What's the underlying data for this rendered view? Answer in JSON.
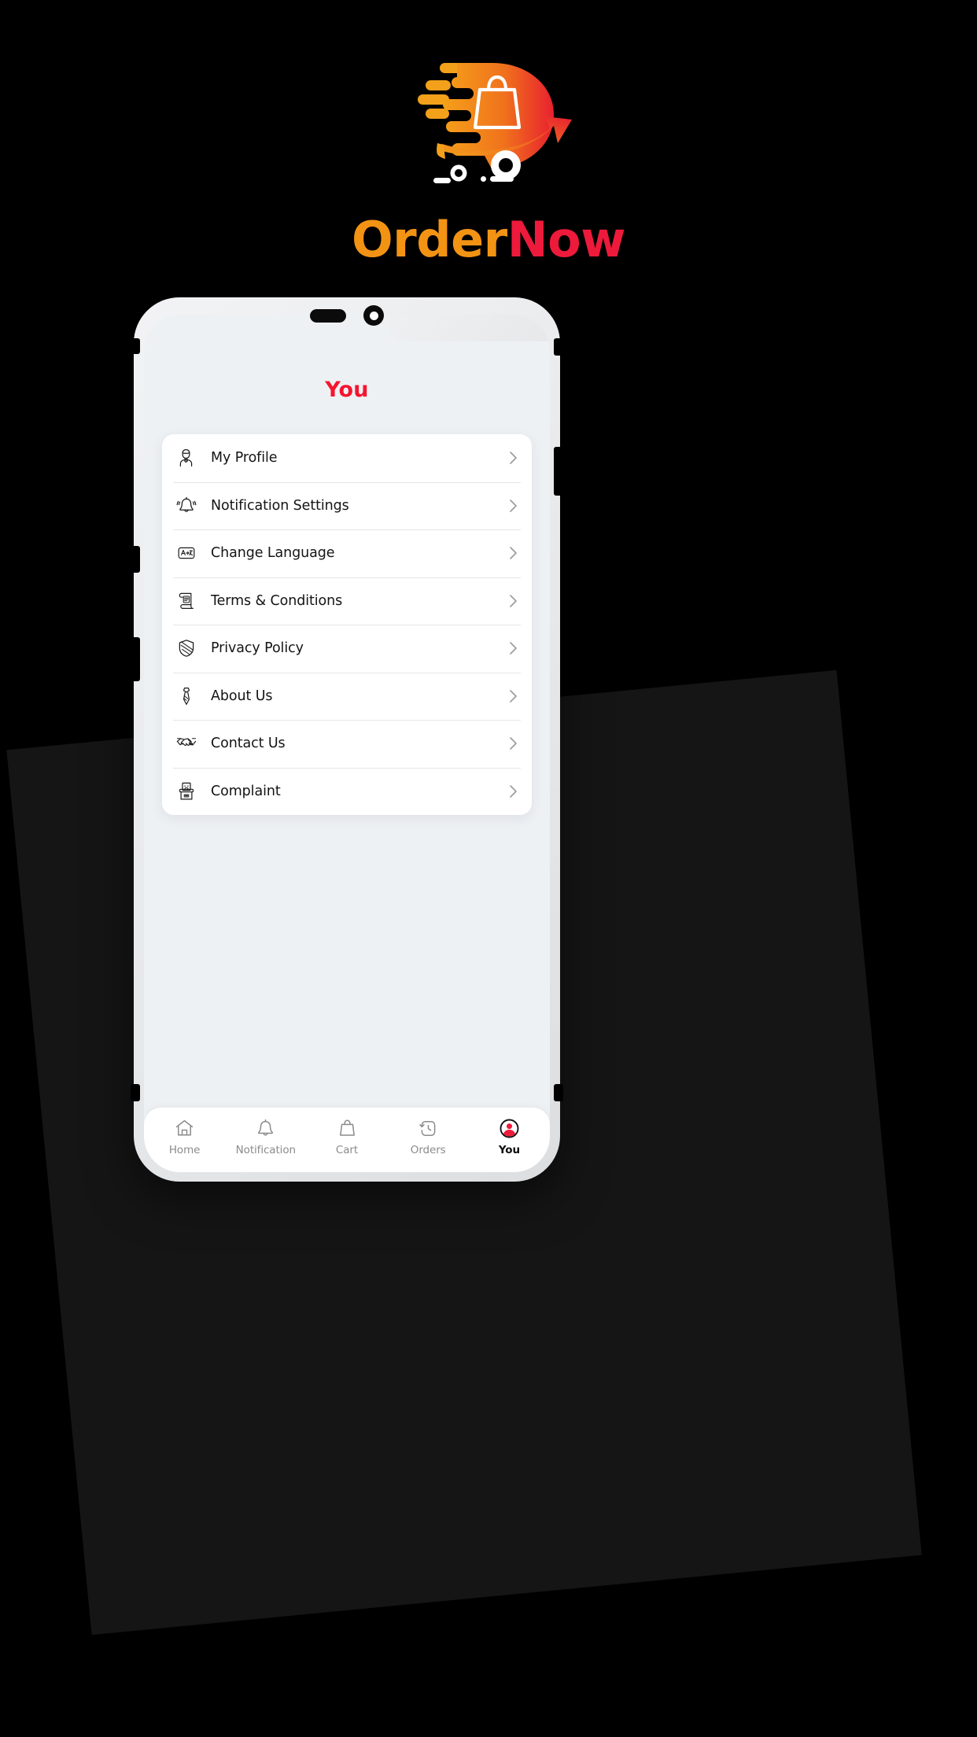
{
  "brand": {
    "name_part1": "Order",
    "name_part2": "Now",
    "logo_icon": "delivery-scooter-bag-logo",
    "color_orange": "#F39314",
    "color_red": "#ED1A3B"
  },
  "phone": {
    "speaker_icon": "phone-speaker",
    "camera_icon": "front-camera"
  },
  "screen": {
    "title": "You",
    "title_color": "#F5152F",
    "menu": [
      {
        "icon": "person-icon",
        "label": "My Profile",
        "chevron": "chevron-right-icon"
      },
      {
        "icon": "bell-icon",
        "label": "Notification Settings",
        "chevron": "chevron-right-icon"
      },
      {
        "icon": "translate-icon",
        "label": "Change Language",
        "chevron": "chevron-right-icon"
      },
      {
        "icon": "scroll-icon",
        "label": "Terms & Conditions",
        "chevron": "chevron-right-icon"
      },
      {
        "icon": "shield-icon",
        "label": "Privacy Policy",
        "chevron": "chevron-right-icon"
      },
      {
        "icon": "necktie-icon",
        "label": "About Us",
        "chevron": "chevron-right-icon"
      },
      {
        "icon": "handshake-icon",
        "label": "Contact Us",
        "chevron": "chevron-right-icon"
      },
      {
        "icon": "complaint-box-icon",
        "label": "Complaint",
        "chevron": "chevron-right-icon"
      }
    ],
    "bottom_nav": {
      "active_color": "#F5152F",
      "inactive_color": "#8b8b8b",
      "items": [
        {
          "icon": "home-icon",
          "label": "Home",
          "active": false
        },
        {
          "icon": "bell-icon",
          "label": "Notification",
          "active": false
        },
        {
          "icon": "shopping-bag-icon",
          "label": "Cart",
          "active": false
        },
        {
          "icon": "history-clock-icon",
          "label": "Orders",
          "active": false
        },
        {
          "icon": "account-circle-icon",
          "label": "You",
          "active": true
        }
      ]
    }
  }
}
